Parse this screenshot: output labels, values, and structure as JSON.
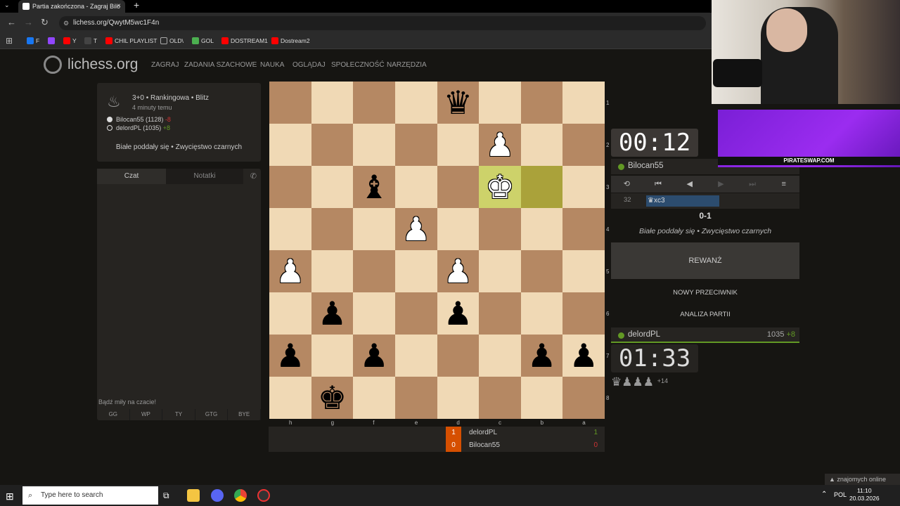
{
  "browser": {
    "tab_title": "Partia zakończona - Zagraj Bilo",
    "tab_close": "×",
    "menu_glyph": "⌄",
    "new_tab": "+",
    "url": "lichess.org/QwytM5wc1F4n",
    "bookmarks": [
      {
        "label": "F",
        "color": "#1877f2"
      },
      {
        "label": "",
        "color": "#9146ff"
      },
      {
        "label": "Y",
        "color": "#ff0000"
      },
      {
        "label": "T",
        "color": "#444444"
      },
      {
        "label": "CHIL PLAYLIST",
        "color": "#ff0000"
      },
      {
        "label": "OLD\\",
        "color": "#888888"
      },
      {
        "label": "GOL",
        "color": "#4caf50"
      },
      {
        "label": "DOSTREAM1",
        "color": "#ff0000"
      },
      {
        "label": "Dostream2",
        "color": "#ff0000"
      }
    ]
  },
  "site": {
    "logo": "lichess.org",
    "nav": [
      "ZAGRAJ",
      "ZADANIA SZACHOWE",
      "NAUKA",
      "OGLĄDAJ",
      "SPOŁECZNOŚĆ",
      "NARZĘDZIA"
    ]
  },
  "game_info": {
    "setup": "3+0 • Rankingowa • Blitz",
    "time_ago": "4 minuty temu",
    "white_player": "Bilocan55 (1128)",
    "white_diff": "-8",
    "black_player": "delordPL (1035)",
    "black_diff": "+8",
    "status": "Białe poddały się • Zwycięstwo czarnych"
  },
  "chat": {
    "tab_chat": "Czat",
    "tab_notes": "Notatki",
    "placeholder": "Bądź miły na czacie!",
    "presets": [
      "GG",
      "WP",
      "TY",
      "GTG",
      "BYE"
    ]
  },
  "board": {
    "orientation": "black",
    "rank_labels": [
      "1",
      "2",
      "3",
      "4",
      "5",
      "6",
      "7",
      "8"
    ],
    "file_labels": [
      "h",
      "g",
      "f",
      "e",
      "d",
      "c",
      "b",
      "a"
    ],
    "highlight": [
      "c3",
      "b3"
    ],
    "pieces": [
      {
        "sq": "d1",
        "glyph": "♛",
        "side": "b"
      },
      {
        "sq": "c2",
        "glyph": "♟",
        "side": "w"
      },
      {
        "sq": "f3",
        "glyph": "♝",
        "side": "b"
      },
      {
        "sq": "c3",
        "glyph": "♚",
        "side": "w"
      },
      {
        "sq": "e4",
        "glyph": "♟",
        "side": "w"
      },
      {
        "sq": "h5",
        "glyph": "♟",
        "side": "w"
      },
      {
        "sq": "d5",
        "glyph": "♟",
        "side": "w"
      },
      {
        "sq": "g6",
        "glyph": "♟",
        "side": "b"
      },
      {
        "sq": "d6",
        "glyph": "♟",
        "side": "b"
      },
      {
        "sq": "h7",
        "glyph": "♟",
        "side": "b"
      },
      {
        "sq": "f7",
        "glyph": "♟",
        "side": "b"
      },
      {
        "sq": "b7",
        "glyph": "♟",
        "side": "b"
      },
      {
        "sq": "a7",
        "glyph": "♟",
        "side": "b"
      },
      {
        "sq": "g8",
        "glyph": "♚",
        "side": "b"
      }
    ]
  },
  "crosstable": [
    {
      "score": "1",
      "name": "delordPL",
      "result": "1",
      "result_color": "#629924"
    },
    {
      "score": "0",
      "name": "Bilocan55",
      "result": "0",
      "result_color": "#cc3333"
    }
  ],
  "right_panel": {
    "clock_top": "00:12",
    "opponent": "Bilocan55",
    "controls": [
      "⟲",
      "⏮",
      "◀",
      "▶",
      "⏭",
      "≡"
    ],
    "move_number": "32",
    "move_san": "♛xc3",
    "result": "0-1",
    "result_status": "Białe poddały się • Zwycięstwo czarnych",
    "rematch": "REWANŻ",
    "new_opponent": "NOWY PRZECIWNIK",
    "analysis": "ANALIZA PARTII",
    "self": "delordPL",
    "self_rating": "1035",
    "self_diff": "+8",
    "clock_bottom": "01:33",
    "captured": "♛♟♟♟",
    "material_adv": "+14"
  },
  "stream": {
    "sponsor": "PIRATESWAP.COM"
  },
  "online": "▲ znajomych online",
  "taskbar": {
    "search_placeholder": "Type here to search",
    "lang": "POL",
    "time": "11:10",
    "date": "20.03.2026"
  }
}
